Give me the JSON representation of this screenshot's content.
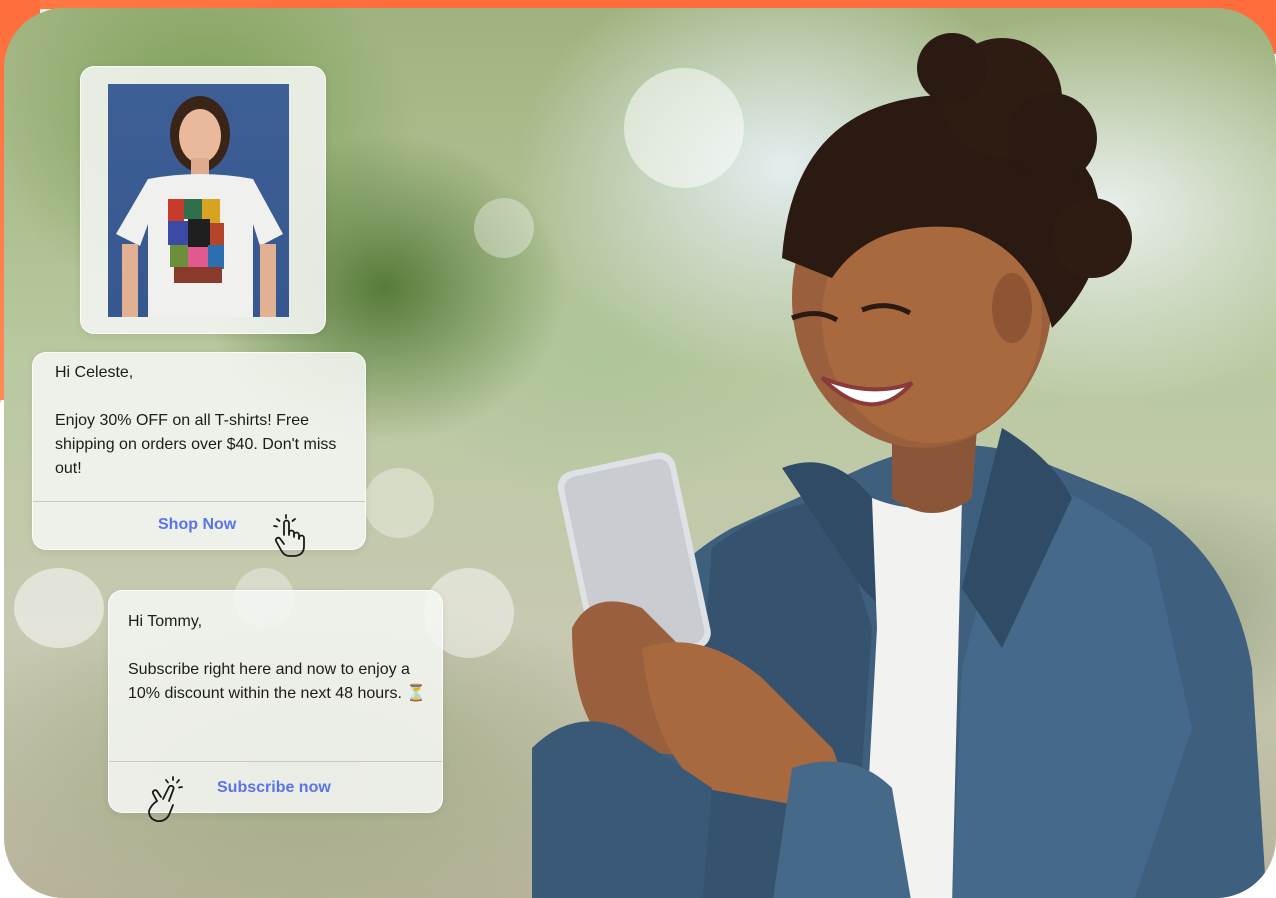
{
  "card_celeste": {
    "greeting": "Hi Celeste,",
    "body": "Enjoy 30% OFF on all T-shirts! Free shipping on orders over $40. Don't miss out!",
    "cta_label": "Shop Now",
    "cta_icon": "tap-hand-icon"
  },
  "card_tommy": {
    "greeting": "Hi Tommy,",
    "body": "Subscribe right here and now to enjoy a 10% discount within the next 48 hours. ⏳",
    "cta_label": "Subscribe now",
    "cta_icon": "tap-hand-icon"
  },
  "colors": {
    "accent_orange": "#ff6d3c",
    "cta_blue": "#5b73e8",
    "card_bg": "#f4f6f2"
  }
}
